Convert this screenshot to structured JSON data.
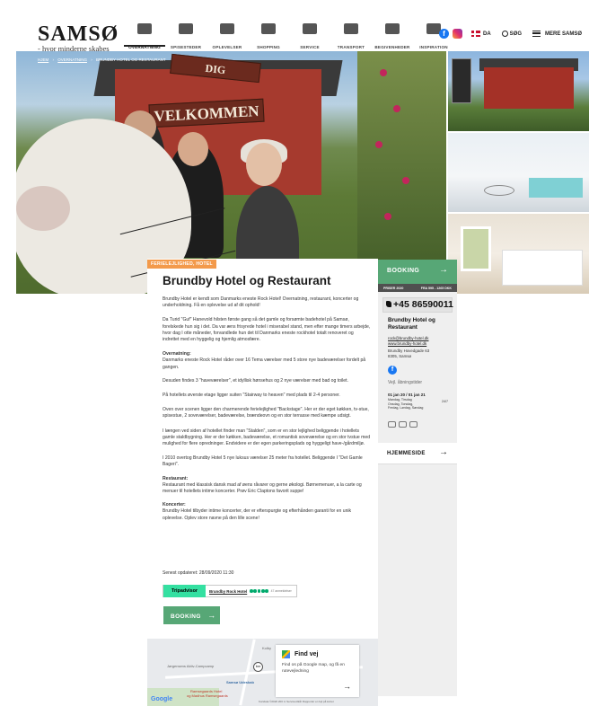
{
  "brand": {
    "logo": "SAMSØ",
    "tagline": "- hvor minderne skabes"
  },
  "nav": {
    "items": [
      {
        "label": "OVERNATNING",
        "icon": "bed-icon"
      },
      {
        "label": "SPISESTEDER",
        "icon": "dining-icon"
      },
      {
        "label": "OPLEVELSER",
        "icon": "bike-icon"
      },
      {
        "label": "SHOPPING",
        "icon": "shopping-bag-icon"
      },
      {
        "label": "SERVICE",
        "icon": "info-person-icon"
      },
      {
        "label": "TRANSPORT",
        "icon": "car-icon"
      },
      {
        "label": "BEGIVENHEDER",
        "icon": "calendar-icon"
      },
      {
        "label": "INSPIRATION",
        "icon": "star-icon"
      }
    ],
    "lang": "DA",
    "search": "SØG",
    "menu": "MERE SAMSØ"
  },
  "breadcrumb": {
    "home": "HJEM",
    "section": "OVERNATNING",
    "current": "BRUNDBY HOTEL OG RESTAURANT"
  },
  "hero": {
    "sign_top": "DIG",
    "sign_main": "VELKOMMEN"
  },
  "badge": "FERIELEJLIGHED, HOTEL",
  "title": "Brundby Hotel og Restaurant",
  "body": {
    "p1": "Brundby Hotel er kendt som Danmarks eneste Rock Hotel! Overnatning, restaurant, koncerter og underholdning. Få en oplevelse ud af dit ophold!",
    "p2": "Da Turid \"Guf\" Hanevold hilsten første gang så det gamle og forsømte badehotel på Samsø, forelskede hun sig i det. Da var æns frisyrede hotel i miserabel stand, men efter mange timers arbejde, hvor dag I otte måneder, forvandlede hun det til Danmarks eneste rockhotel totalt renoveret og indrettet med en hyggelig og hjemlig atmosfære.",
    "lead1": "Overnatning:",
    "p3": "Danmarks eneste Rock Hotel råder over 16 Tema værelser med 5 store nye badeværelser fordelt på gangen.",
    "p4": "Desuden findes 3 \"haveværelser\", et idyllisk hønsehus og 2 nye værelser med bad og toilet.",
    "p5": "På hotellets øverste etage ligger suiten \"Stairway to heaven\" med plads til 2-4 personer.",
    "p6": "Oven over scenen ligger den charmerende ferielejlighed \"Backstage\". Her er der eget køkken, tv-stue, spisestue, 2 soveværelser, badeværelse, brændeovn og en stor terrasse med kæmpe udsigt.",
    "p7": "I længen ved siden af hotellet finder man \"Stalden\", som er en stor lejlighed beliggende i hotellets gamle staldbygning. Her er der køkken, badeværelse, et romantisk soveværelse og en stor tvstue med mulighed for flere opredninger. Endvidere er der egen parkeringsplads og hyggeligt have-/gårdmiljø.",
    "p8": "I 2010 overtog Brundby Hotel 5 nye luksus værelser 25 meter fra hotellet. Beliggende I \"Det Gamle Bageri\".",
    "lead2": "Restaurant:",
    "p9": "Restaurant med klassisk dansk mad af øens råvarer og gerne økologi. Børnemenuer, a la carte og menuer til hotellets intime koncerter. Prøv Eric Claptons favorit suppe!",
    "lead3": "Koncerter:",
    "p10": "Brundby Hotel tilbyder intime koncerter, der er efterspurgte og efterhånden garanti for en unik oplevelse. Oplev store navne på den lille scene!"
  },
  "updated": "Senest opdateret: 28/09/2020 11:30",
  "tripadvisor": {
    "logo": "Tripadvisor",
    "name": "Brundby Rock Hotel",
    "rating": 5,
    "count": "47 anmeldelser"
  },
  "booking_label": "BOOKING",
  "map": {
    "labels": [
      "Jørgensens Aktiv-Campcamp",
      "Kolby",
      "Samsø Udeskab",
      "Ramsegaards Hotel",
      "og Madhus Ramsegaards"
    ],
    "find_title": "Find vej",
    "find_text": "Find os på Google map, og få en rutevejledning",
    "google": "Google",
    "footer": "Kortdata ©2020   200 m          Servicevilkår   Rapportér en fejl på kortet",
    "pin": "bm"
  },
  "sidebar": {
    "booking": "BOOKING",
    "price_label": "PRISER 2020",
    "price_value": "FRA 595 - 1265 DKK",
    "phone": "+45 86590011",
    "name": "Brundby Hotel og Restaurant",
    "email": "rock@brundby-hotel.dk",
    "website": "www.brundby-hotel.dk",
    "address1": "Brundby Hovedgade 63",
    "address2": "8305, Samsø",
    "hours_label": "Vejl. åbningstider",
    "hours_dates": "01 jan 20 / 01 jan 21",
    "hours_days": [
      "Mandag, Tirsdag",
      "Onsdag, Torsdag,",
      "Fredag, Lørdag, Søndag"
    ],
    "hours_time": "24/7",
    "homepage": "HJEMMESIDE"
  },
  "colors": {
    "green": "#57a776",
    "orange": "#f39a4b",
    "grey_panel": "#efefef"
  }
}
